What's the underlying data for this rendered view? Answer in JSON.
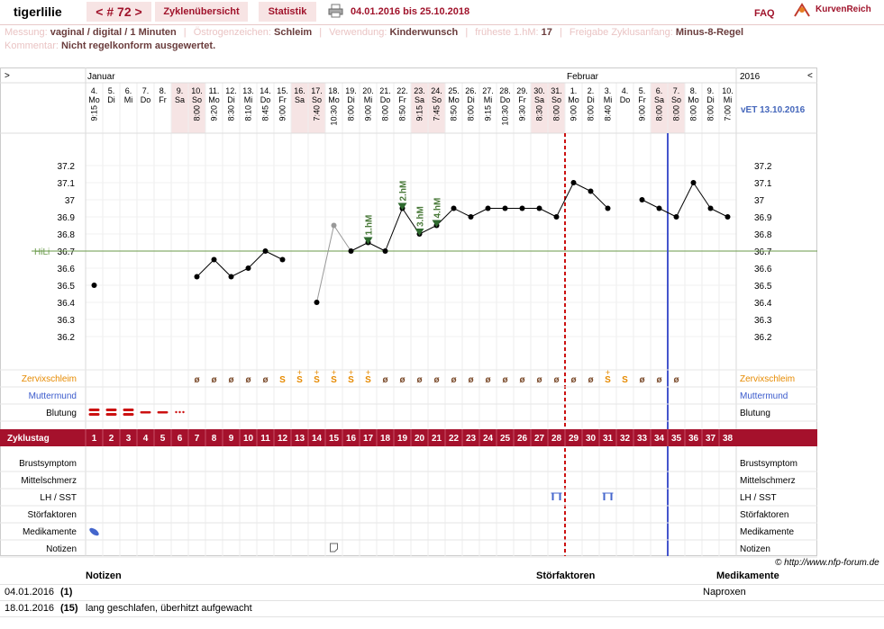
{
  "header": {
    "user": "tigerlilie",
    "cycle_label": "< # 72 >",
    "tab_overview": "Zyklenübersicht",
    "tab_stats": "Statistik",
    "date_range": "04.01.2016 bis 25.10.2018",
    "faq": "FAQ",
    "brand": "KurvenReich"
  },
  "info": {
    "messung_label": "Messung:",
    "messung_value": "vaginal / digital / 1 Minuten",
    "oestrogen_label": "Östrogenzeichen:",
    "oestrogen_value": "Schleim",
    "verwendung_label": "Verwendung:",
    "verwendung_value": "Kinderwunsch",
    "fhm_label": "früheste 1.hM:",
    "fhm_value": "17",
    "freigabe_label": "Freigabe Zyklusanfang:",
    "freigabe_value": "Minus-8-Regel",
    "kommentar_label": "Kommentar:",
    "kommentar_value": "Nicht regelkonform ausgewertet."
  },
  "chart_labels": {
    "nav_left": ">",
    "nav_right": "<",
    "month1": "Januar",
    "month2": "Februar",
    "year": "2016",
    "vet": "vET 13.10.2016",
    "hili": "HiLi",
    "zervix": "Zervixschleim",
    "muttermund": "Muttermund",
    "blutung": "Blutung",
    "zyklustag": "Zyklustag",
    "brust": "Brustsymptom",
    "mittel": "Mittelschmerz",
    "lh": "LH / SST",
    "stoer": "Störfaktoren",
    "medi": "Medikamente",
    "notizen": "Notizen",
    "copyright": "© http://www.nfp-forum.de"
  },
  "chart_data": {
    "type": "line",
    "y_ticks": [
      "37.2",
      "37.1",
      "37",
      "36.9",
      "36.8",
      "36.7",
      "36.6",
      "36.5",
      "36.4",
      "36.3",
      "36.2"
    ],
    "ylim": [
      36.2,
      37.2
    ],
    "hili": 36.7,
    "days": [
      {
        "d": "4.",
        "w": "Mo",
        "t": "9:15",
        "v": 36.5,
        "z": "",
        "b": "h",
        "cd": "1"
      },
      {
        "d": "5.",
        "w": "Di",
        "t": "",
        "v": null,
        "z": "",
        "b": "h",
        "cd": "2"
      },
      {
        "d": "6.",
        "w": "Mi",
        "t": "",
        "v": null,
        "z": "",
        "b": "h",
        "cd": "3"
      },
      {
        "d": "7.",
        "w": "Do",
        "t": "",
        "v": null,
        "z": "",
        "b": "m",
        "cd": "4"
      },
      {
        "d": "8.",
        "w": "Fr",
        "t": "",
        "v": null,
        "z": "",
        "b": "m",
        "cd": "5"
      },
      {
        "d": "9.",
        "w": "Sa",
        "t": "",
        "v": null,
        "z": "",
        "b": "s",
        "cd": "6"
      },
      {
        "d": "10.",
        "w": "So",
        "t": "8:00",
        "v": 36.55,
        "z": "ø",
        "b": "",
        "cd": "7"
      },
      {
        "d": "11.",
        "w": "Mo",
        "t": "9:20",
        "v": 36.65,
        "z": "ø",
        "b": "",
        "cd": "8"
      },
      {
        "d": "12.",
        "w": "Di",
        "t": "8:30",
        "v": 36.55,
        "z": "ø",
        "b": "",
        "cd": "9"
      },
      {
        "d": "13.",
        "w": "Mi",
        "t": "8:10",
        "v": 36.6,
        "z": "ø",
        "b": "",
        "cd": "10"
      },
      {
        "d": "14.",
        "w": "Do",
        "t": "8:45",
        "v": 36.7,
        "z": "ø",
        "b": "",
        "cd": "11"
      },
      {
        "d": "15.",
        "w": "Fr",
        "t": "9:00",
        "v": 36.65,
        "z": "S",
        "b": "",
        "cd": "12"
      },
      {
        "d": "16.",
        "w": "Sa",
        "t": "",
        "v": null,
        "z": "S+",
        "b": "",
        "cd": "13"
      },
      {
        "d": "17.",
        "w": "So",
        "t": "7:40",
        "v": 36.4,
        "z": "S+",
        "b": "",
        "cd": "14"
      },
      {
        "d": "18.",
        "w": "Mo",
        "t": "10:30",
        "v": 36.85,
        "z": "S+",
        "b": "",
        "cd": "15"
      },
      {
        "d": "19.",
        "w": "Di",
        "t": "8:00",
        "v": 36.7,
        "z": "S+",
        "b": "",
        "cd": "16"
      },
      {
        "d": "20.",
        "w": "Mi",
        "t": "9:00",
        "v": 36.75,
        "z": "S+",
        "b": "",
        "cd": "17"
      },
      {
        "d": "21.",
        "w": "Do",
        "t": "8:00",
        "v": 36.7,
        "z": "ø",
        "b": "",
        "cd": "18"
      },
      {
        "d": "22.",
        "w": "Fr",
        "t": "8:50",
        "v": 36.95,
        "z": "ø",
        "b": "",
        "cd": "19"
      },
      {
        "d": "23.",
        "w": "Sa",
        "t": "9:15",
        "v": 36.8,
        "z": "ø",
        "b": "",
        "cd": "20"
      },
      {
        "d": "24.",
        "w": "So",
        "t": "7:45",
        "v": 36.85,
        "z": "ø",
        "b": "",
        "cd": "21"
      },
      {
        "d": "25.",
        "w": "Mo",
        "t": "8:50",
        "v": 36.95,
        "z": "ø",
        "b": "",
        "cd": "22"
      },
      {
        "d": "26.",
        "w": "Di",
        "t": "8:00",
        "v": 36.9,
        "z": "ø",
        "b": "",
        "cd": "23"
      },
      {
        "d": "27.",
        "w": "Mi",
        "t": "9:15",
        "v": 36.95,
        "z": "ø",
        "b": "",
        "cd": "24"
      },
      {
        "d": "28.",
        "w": "Do",
        "t": "10:30",
        "v": 36.95,
        "z": "ø",
        "b": "",
        "cd": "25"
      },
      {
        "d": "29.",
        "w": "Fr",
        "t": "9:30",
        "v": 36.95,
        "z": "ø",
        "b": "",
        "cd": "26"
      },
      {
        "d": "30.",
        "w": "Sa",
        "t": "8:30",
        "v": 36.95,
        "z": "ø",
        "b": "",
        "cd": "27"
      },
      {
        "d": "31.",
        "w": "So",
        "t": "8:00",
        "v": 36.9,
        "z": "ø",
        "b": "",
        "cd": "28"
      },
      {
        "d": "1.",
        "w": "Mo",
        "t": "9:00",
        "v": 37.1,
        "z": "ø",
        "b": "",
        "cd": "29"
      },
      {
        "d": "2.",
        "w": "Di",
        "t": "8:00",
        "v": 37.05,
        "z": "ø",
        "b": "",
        "cd": "30"
      },
      {
        "d": "3.",
        "w": "Mi",
        "t": "8:40",
        "v": 36.95,
        "z": "S+",
        "b": "",
        "cd": "31"
      },
      {
        "d": "4.",
        "w": "Do",
        "t": "",
        "v": null,
        "z": "S",
        "b": "",
        "cd": "32"
      },
      {
        "d": "5.",
        "w": "Fr",
        "t": "9:00",
        "v": 37.0,
        "z": "ø",
        "b": "",
        "cd": "33"
      },
      {
        "d": "6.",
        "w": "Sa",
        "t": "8:00",
        "v": 36.95,
        "z": "ø",
        "b": "",
        "cd": "34"
      },
      {
        "d": "7.",
        "w": "So",
        "t": "8:00",
        "v": 36.9,
        "z": "ø",
        "b": "",
        "cd": "35"
      },
      {
        "d": "8.",
        "w": "Mo",
        "t": "8:00",
        "v": 37.1,
        "z": "",
        "b": "",
        "cd": "36"
      },
      {
        "d": "9.",
        "w": "Di",
        "t": "8:00",
        "v": 36.95,
        "z": "",
        "b": "",
        "cd": "37"
      },
      {
        "d": "10.",
        "w": "Mi",
        "t": "7:00",
        "v": 36.9,
        "z": "",
        "b": "",
        "cd": "38"
      }
    ],
    "excluded": [
      14
    ],
    "hm_markers": [
      {
        "label": "1.hM",
        "day": 17
      },
      {
        "label": "2.hM",
        "day": 19
      },
      {
        "label": "3.hM",
        "day": 20
      },
      {
        "label": "4.hM",
        "day": 21
      }
    ],
    "lh_marks": [
      28,
      31
    ]
  },
  "notes": {
    "col_notizen": "Notizen",
    "col_stoer": "Störfaktoren",
    "col_medi": "Medikamente",
    "rows": [
      {
        "date": "04.01.2016",
        "cd": "(1)",
        "note": "",
        "med": "Naproxen"
      },
      {
        "date": "18.01.2016",
        "cd": "(15)",
        "note": "lang geschlafen, überhitzt aufgewacht",
        "med": ""
      }
    ]
  }
}
